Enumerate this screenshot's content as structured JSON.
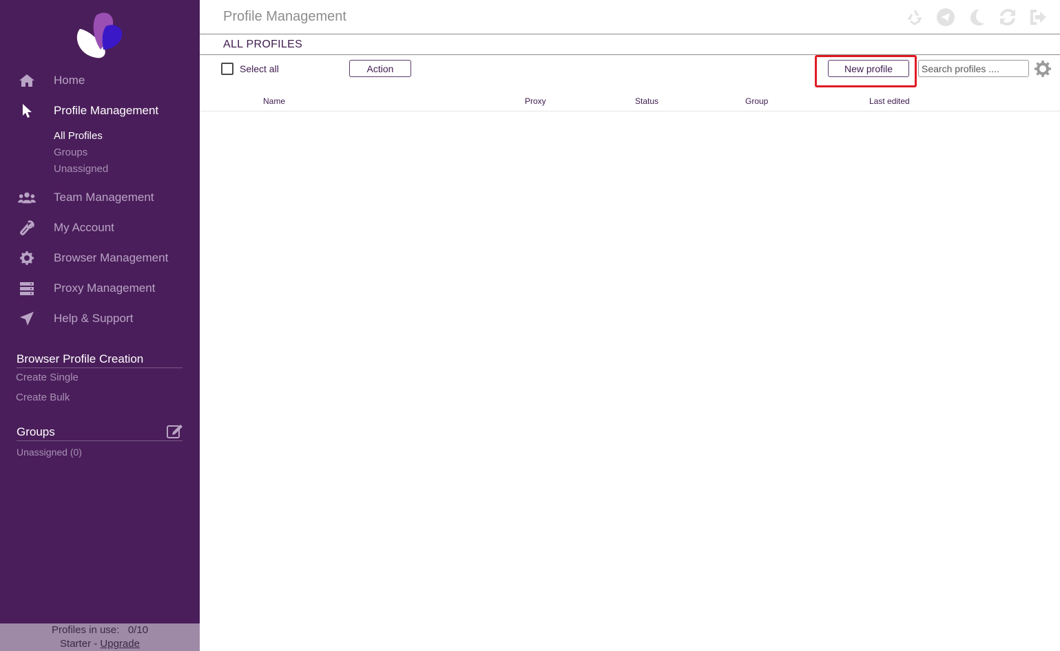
{
  "app": {
    "title": "Profile Management"
  },
  "colors": {
    "sidebar_bg": "#4a1e5a",
    "accent": "#3d1a4e",
    "highlight": "#e01b24",
    "footer_bg": "#9e8aa6"
  },
  "sidebar": {
    "nav": [
      {
        "label": "Home",
        "icon": "home-icon",
        "active": false
      },
      {
        "label": "Profile Management",
        "icon": "cursor-pointer-icon",
        "active": true
      },
      {
        "label": "Team Management",
        "icon": "users-icon",
        "active": false
      },
      {
        "label": "My Account",
        "icon": "wrench-icon",
        "active": false
      },
      {
        "label": "Browser Management",
        "icon": "gear-icon",
        "active": false
      },
      {
        "label": "Proxy Management",
        "icon": "server-icon",
        "active": false
      },
      {
        "label": "Help & Support",
        "icon": "paper-plane-icon",
        "active": false
      }
    ],
    "profile_sub": [
      "All Profiles",
      "Groups",
      "Unassigned"
    ],
    "creation": {
      "title": "Browser Profile Creation",
      "links": [
        "Create Single",
        "Create Bulk"
      ]
    },
    "groups": {
      "title": "Groups",
      "items": [
        "Unassigned (0)"
      ]
    },
    "footer": {
      "usage_label": "Profiles in use:",
      "usage_value": "0/10",
      "plan": "Starter",
      "separator": " - ",
      "upgrade": "Upgrade"
    }
  },
  "topbar": {
    "icons": [
      "recycle-icon",
      "telegram-icon",
      "moon-icon",
      "refresh-icon",
      "sign-out-icon"
    ]
  },
  "main": {
    "section_title": "ALL PROFILES",
    "select_all": "Select all",
    "action_label": "Action",
    "new_profile_label": "New profile",
    "search_placeholder": "Search profiles ....",
    "columns": [
      "Name",
      "Proxy",
      "Status",
      "Group",
      "Last edited"
    ]
  }
}
